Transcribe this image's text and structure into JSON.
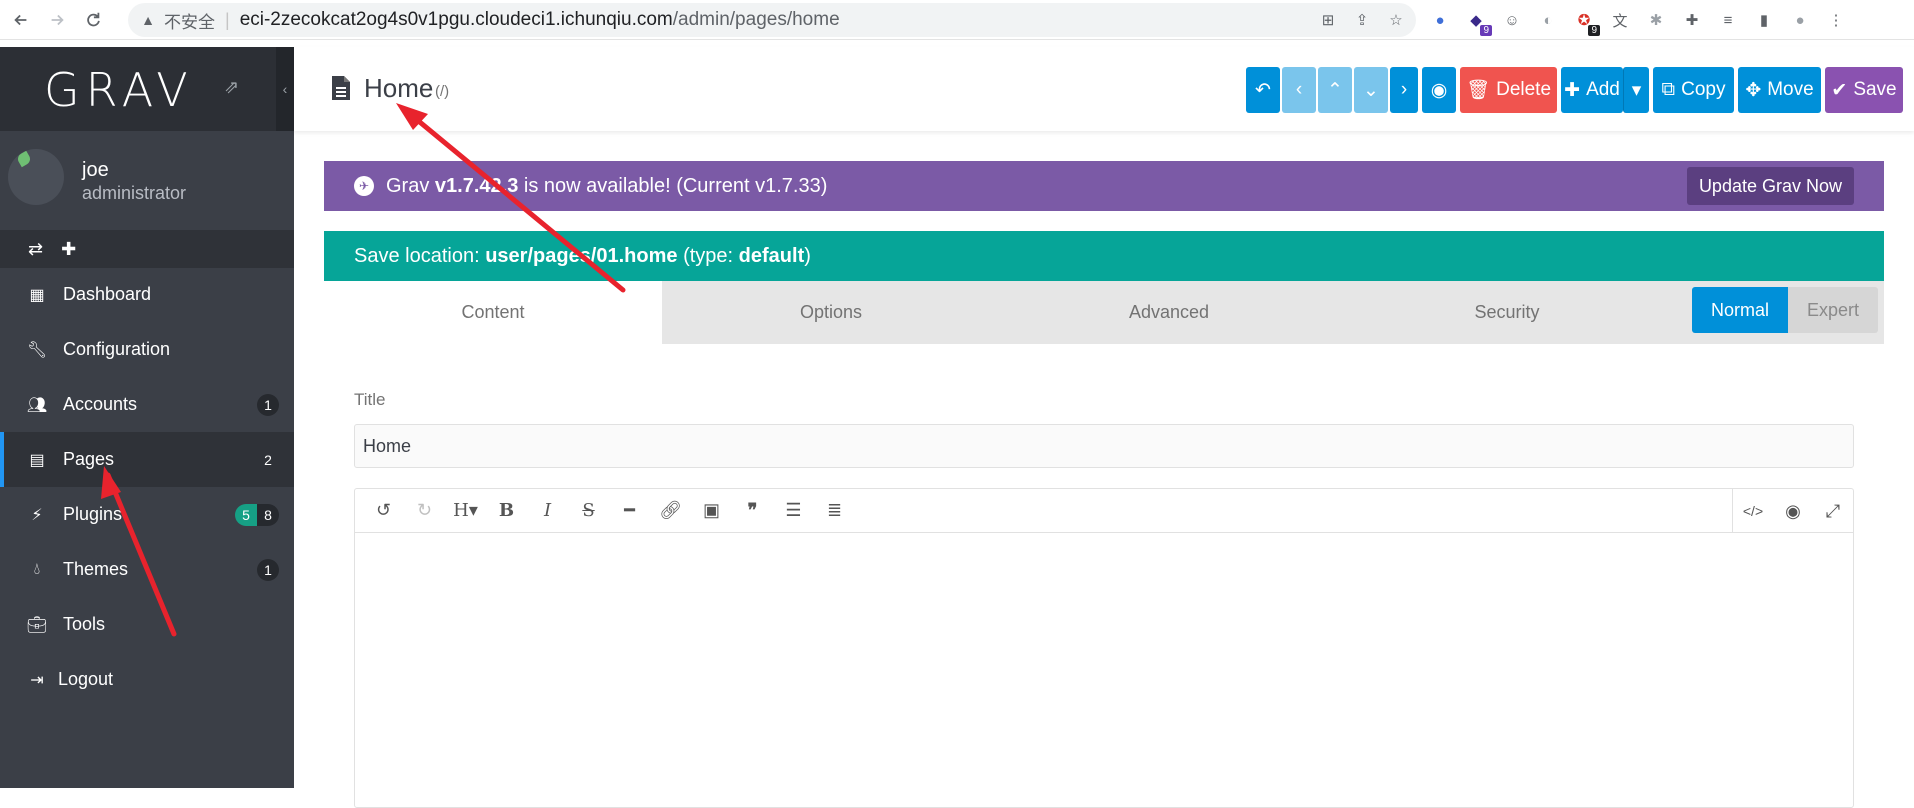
{
  "browser": {
    "insecure_label": "不安全",
    "url_host": "eci-2zecokcat2og4s0v1pgu.cloudeci1.ichunqiu.com",
    "url_path": "/admin/pages/home",
    "ext_badge_1": "9",
    "ext_badge_2": "9"
  },
  "sidebar": {
    "logo": "GRAV",
    "user": {
      "name": "joe",
      "role": "administrator"
    },
    "items": [
      {
        "label": "Dashboard"
      },
      {
        "label": "Configuration"
      },
      {
        "label": "Accounts",
        "count": "1"
      },
      {
        "label": "Pages",
        "count": "2"
      },
      {
        "label": "Plugins",
        "count_a": "5",
        "count_b": "8"
      },
      {
        "label": "Themes",
        "count": "1"
      },
      {
        "label": "Tools"
      },
      {
        "label": "Logout"
      }
    ]
  },
  "header": {
    "title": "Home",
    "route": "(/)",
    "buttons": {
      "delete": "Delete",
      "add": "Add",
      "copy": "Copy",
      "move": "Move",
      "save": "Save"
    }
  },
  "update_banner": {
    "prefix": "Grav",
    "new_version": "v1.7.42.3",
    "middle": "is now available! (Current v1.7.33)",
    "button": "Update Grav Now"
  },
  "save_location": {
    "prefix": "Save location:",
    "path": "user/pages/01.home",
    "type_prefix": "(type:",
    "type": "default",
    "type_suffix": ")"
  },
  "tabs": [
    "Content",
    "Options",
    "Advanced",
    "Security"
  ],
  "mode": {
    "normal": "Normal",
    "expert": "Expert"
  },
  "form": {
    "title_label": "Title",
    "title_value": "Home"
  },
  "colors": {
    "sidebar_bg": "#3b3f47",
    "primary_blue": "#0090d9",
    "update_purple": "#7b5aa6",
    "save_teal": "#06a598",
    "delete_red": "#f0544f",
    "save_purple": "#8a52b0",
    "annotation_red": "#e8232d"
  }
}
